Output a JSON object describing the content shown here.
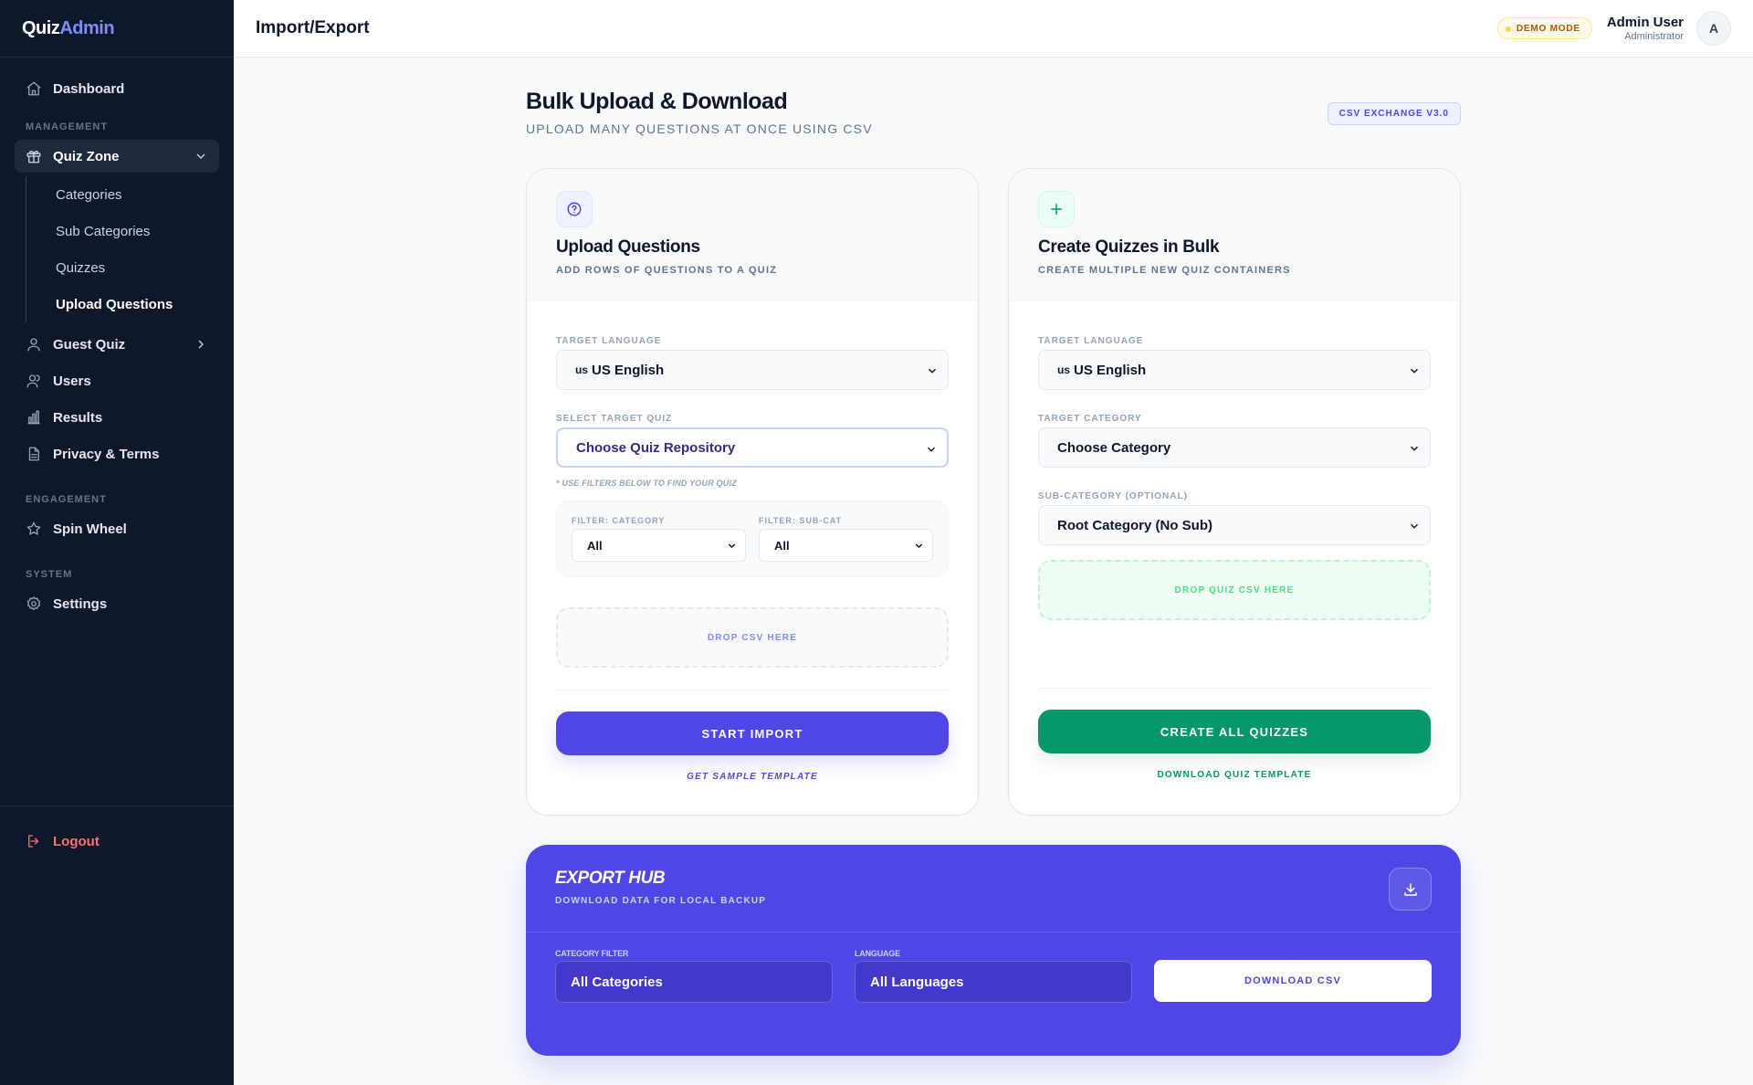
{
  "brand": {
    "part1": "Quiz",
    "part2": "Admin"
  },
  "sidebar": {
    "dashboard": "Dashboard",
    "section_management": "MANAGEMENT",
    "quiz_zone": "Quiz Zone",
    "quiz_zone_children": [
      "Categories",
      "Sub Categories",
      "Quizzes",
      "Upload Questions"
    ],
    "guest_quiz": "Guest Quiz",
    "users": "Users",
    "results": "Results",
    "privacy_terms": "Privacy & Terms",
    "section_engagement": "ENGAGEMENT",
    "spin_wheel": "Spin Wheel",
    "section_system": "SYSTEM",
    "settings": "Settings",
    "logout": "Logout"
  },
  "header": {
    "title": "Import/Export",
    "demo_badge": "DEMO MODE",
    "user_name": "Admin User",
    "user_role": "Administrator",
    "avatar_initial": "A"
  },
  "page": {
    "title": "Bulk Upload & Download",
    "subtitle": "UPLOAD MANY QUESTIONS AT ONCE USING CSV",
    "version_badge": "CSV EXCHANGE V3.0"
  },
  "upload_card": {
    "title": "Upload Questions",
    "subtitle": "ADD ROWS OF QUESTIONS TO A QUIZ",
    "language_label": "TARGET LANGUAGE",
    "language_flag": "us",
    "language_value": "US English",
    "quiz_label": "SELECT TARGET QUIZ",
    "quiz_value": "Choose Quiz Repository",
    "hint": "* USE FILTERS BELOW TO FIND YOUR QUIZ",
    "filter_category_label": "FILTER: CATEGORY",
    "filter_category_value": "All",
    "filter_subcat_label": "FILTER: SUB-CAT",
    "filter_subcat_value": "All",
    "dropzone": "DROP CSV HERE",
    "button": "START IMPORT",
    "template_link": "GET SAMPLE TEMPLATE"
  },
  "bulk_card": {
    "title": "Create Quizzes in Bulk",
    "subtitle": "CREATE MULTIPLE NEW QUIZ CONTAINERS",
    "language_label": "TARGET LANGUAGE",
    "language_flag": "us",
    "language_value": "US English",
    "category_label": "TARGET CATEGORY",
    "category_value": "Choose Category",
    "subcategory_label": "SUB-CATEGORY (OPTIONAL)",
    "subcategory_value": "Root Category (No Sub)",
    "dropzone": "DROP QUIZ CSV HERE",
    "button": "CREATE ALL QUIZZES",
    "template_link": "DOWNLOAD QUIZ TEMPLATE"
  },
  "export_hub": {
    "title": "EXPORT HUB",
    "subtitle": "DOWNLOAD DATA FOR LOCAL BACKUP",
    "category_label": "CATEGORY FILTER",
    "category_value": "All Categories",
    "language_label": "LANGUAGE",
    "language_value": "All Languages",
    "button": "DOWNLOAD CSV"
  },
  "colors": {
    "sidebar_bg": "#0f172a",
    "accent_indigo": "#4f46e5",
    "accent_green": "#059669",
    "logout_red": "#f87171"
  }
}
